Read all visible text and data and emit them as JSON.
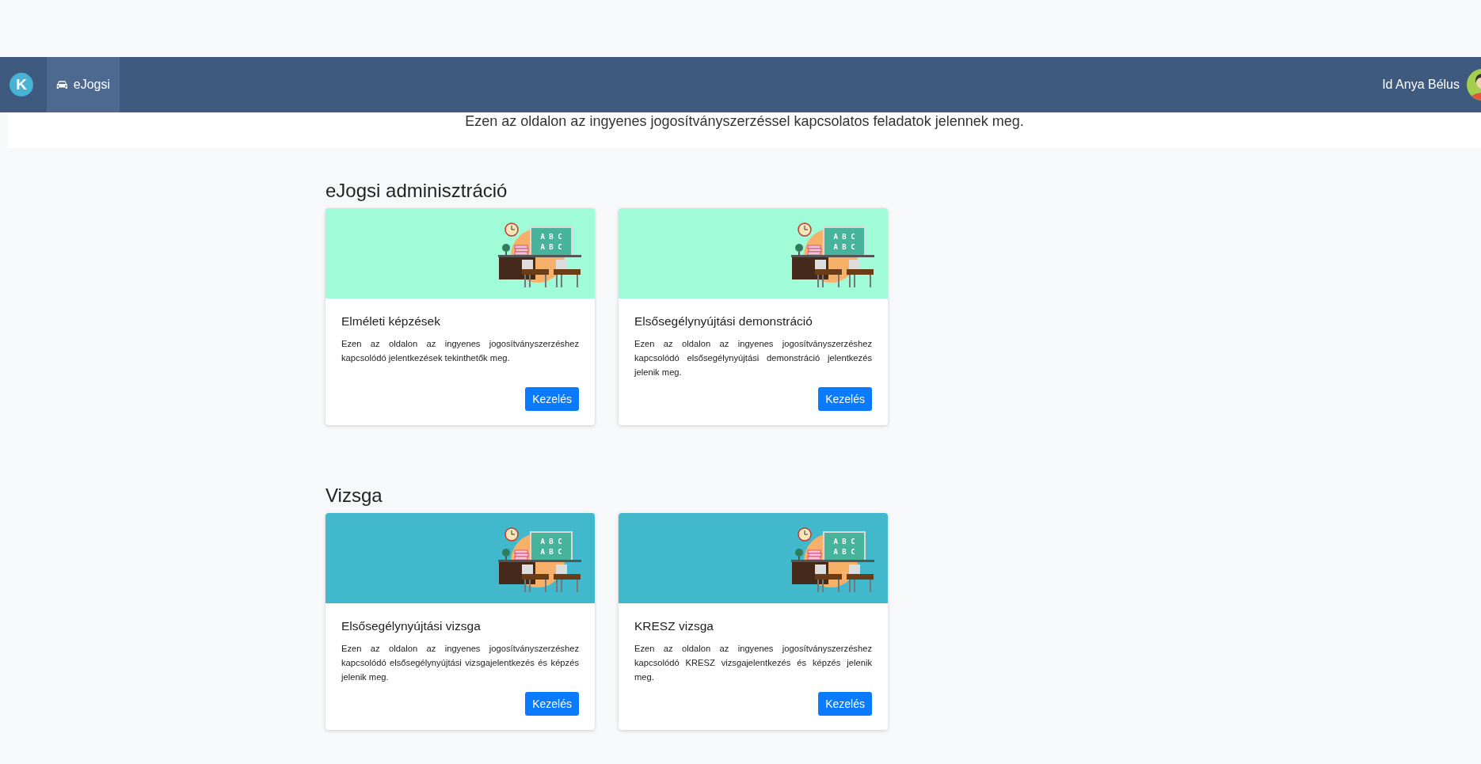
{
  "navbar": {
    "logo_letter": "K",
    "nav_items": [
      {
        "label": "eJogsi",
        "selected": true
      }
    ],
    "user_name": "Id Anya Bélus"
  },
  "intro": "Ezen az oldalon az ingyenes jogosítványszerzéssel kapcsolatos feladatok jelennek meg.",
  "sections": [
    {
      "title": "eJogsi adminisztráció",
      "color": "#a0fcd8",
      "cards": [
        {
          "title": "Elméleti képzések",
          "text": "Ezen az oldalon az ingyenes jogosítványszerzéshez kapcsolódó jelentkezések tekinthetők meg.",
          "button": "Kezelés",
          "board": [
            "A B C",
            "A B C"
          ]
        },
        {
          "title": "Elsősegélynyújtási demonstráció",
          "text": "Ezen az oldalon az ingyenes jogosítványszerzéshez kapcsolódó elsősegélynyújtási demonstráció jelentkezés jelenik meg.",
          "button": "Kezelés",
          "board": [
            "A B C",
            "A B C"
          ]
        }
      ]
    },
    {
      "title": "Vizsga",
      "color": "#42b8cc",
      "cards": [
        {
          "title": "Elsősegélynyújtási vizsga",
          "text": "Ezen az oldalon az ingyenes jogosítványszerzéshez kapcsolódó elsősegélynyújtási vizsgajelentkezés és képzés jelenik meg.",
          "button": "Kezelés",
          "board": [
            "A B C",
            "A B C"
          ]
        },
        {
          "title": "KRESZ vizsga",
          "text": "Ezen az oldalon az ingyenes jogosítványszerzéshez kapcsolódó KRESZ vizsgajelentkezés és képzés jelenik meg.",
          "button": "Kezelés",
          "board": [
            "A B C",
            "A B C"
          ]
        }
      ]
    }
  ]
}
